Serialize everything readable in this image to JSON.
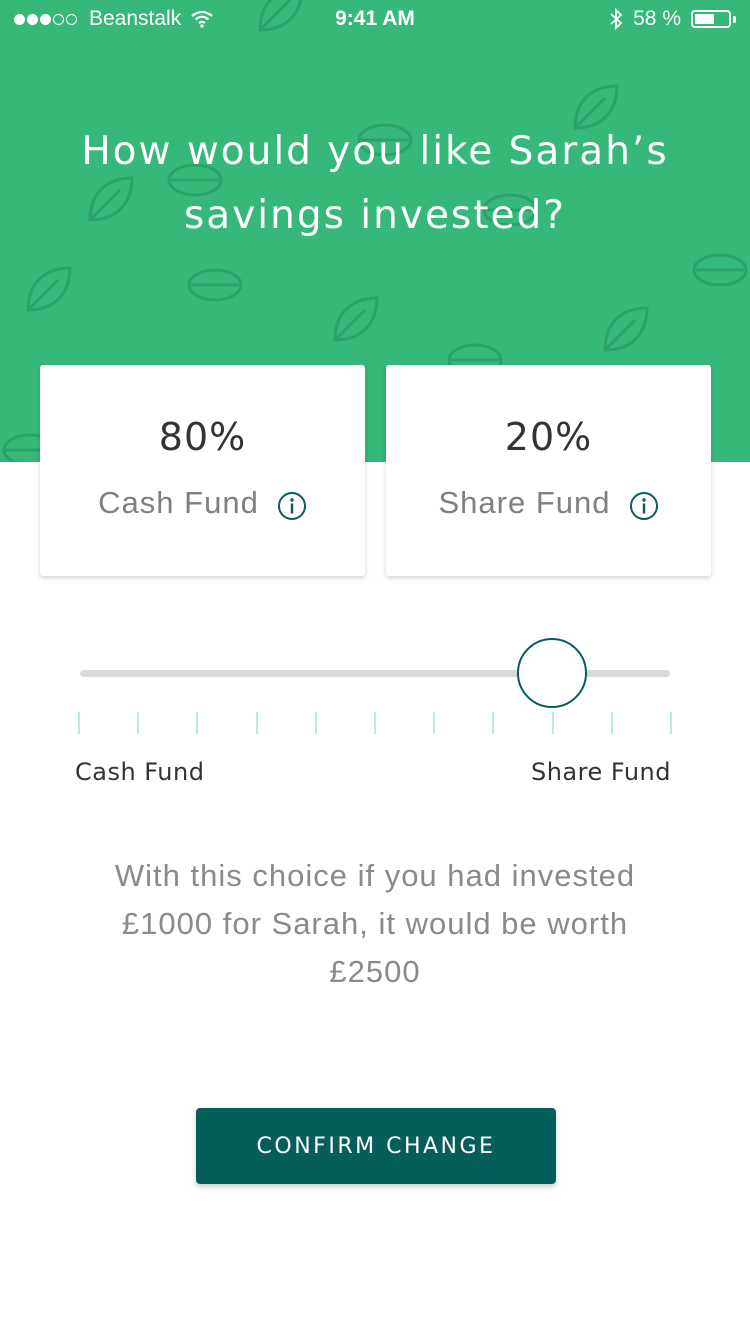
{
  "status_bar": {
    "signal_bars_filled": 3,
    "signal_bars_total": 5,
    "carrier": "Beanstalk",
    "time": "9:41 AM",
    "battery_text": "58 %",
    "battery_level": 0.58
  },
  "header": {
    "title": "How would you like Sarah’s savings invested?"
  },
  "funds": [
    {
      "percent": "80%",
      "label": "Cash Fund"
    },
    {
      "percent": "20%",
      "label": "Share Fund"
    }
  ],
  "slider": {
    "left_label": "Cash Fund",
    "right_label": "Share Fund",
    "share_fraction": 0.8,
    "tick_count": 11
  },
  "projection": {
    "text": "With this choice if you had invested £1000 for Sarah, it would be worth £2500"
  },
  "actions": {
    "confirm_label": "CONFIRM CHANGE"
  },
  "colors": {
    "brand_green": "#36b878",
    "dark_teal": "#065e5a",
    "tick_mint": "#bfe9da",
    "track_grey": "#d9d9d9"
  }
}
